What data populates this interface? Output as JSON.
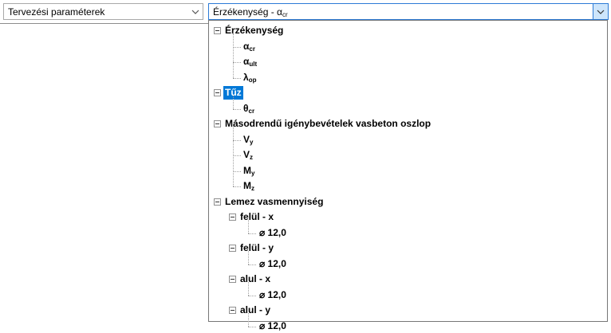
{
  "selector1": {
    "value": "Tervezési paraméterek"
  },
  "selector2": {
    "value_main": "Érzékenység - α",
    "value_sub": "cr"
  },
  "tree": {
    "groups": [
      {
        "label": "Érzékenység",
        "items": [
          {
            "main": "α",
            "sub": "cr"
          },
          {
            "main": "α",
            "sub": "ult"
          },
          {
            "main": "λ",
            "sub": "op"
          }
        ]
      },
      {
        "label": "Tűz",
        "selected": true,
        "items": [
          {
            "main": "θ",
            "sub": "cr"
          }
        ]
      },
      {
        "label": "Másodrendű igénybevételek vasbeton oszlop",
        "items": [
          {
            "main": "V",
            "sub": "y"
          },
          {
            "main": "V",
            "sub": "z"
          },
          {
            "main": "M",
            "sub": "y"
          },
          {
            "main": "M",
            "sub": "z"
          }
        ]
      },
      {
        "label": "Lemez vasmennyiség",
        "subgroups": [
          {
            "label": "felül - x",
            "items": [
              {
                "main": "⌀ 12,0"
              }
            ]
          },
          {
            "label": "felül - y",
            "items": [
              {
                "main": "⌀ 12,0"
              }
            ]
          },
          {
            "label": "alul - x",
            "items": [
              {
                "main": "⌀ 12,0"
              }
            ]
          },
          {
            "label": "alul - y",
            "items": [
              {
                "main": "⌀ 12,0"
              }
            ]
          }
        ]
      }
    ]
  },
  "icons": {
    "dropdown_arrow": "chevron-down-icon",
    "expander": "collapse-minus-icon"
  },
  "colors": {
    "selection": "#0078d7",
    "focus_border": "#2c7ad6",
    "button_hover": "#cde5fb"
  }
}
